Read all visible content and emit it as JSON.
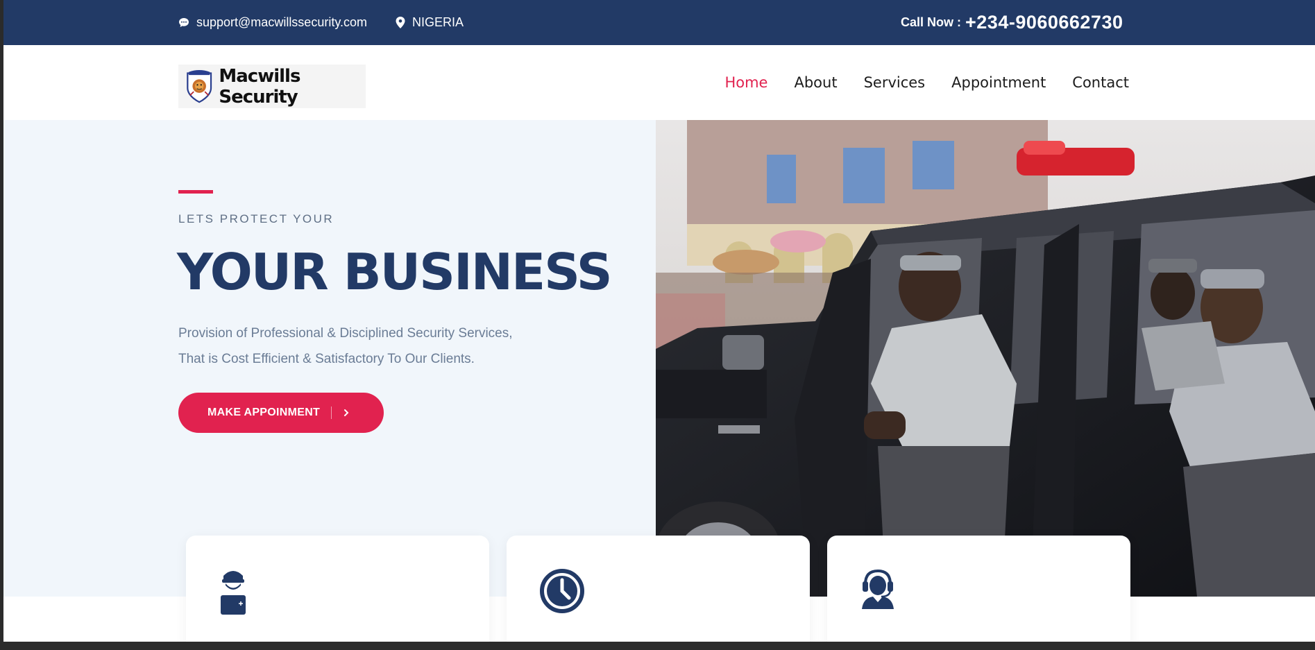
{
  "topbar": {
    "email": "support@macwillssecurity.com",
    "location": "NIGERIA",
    "call_label": "Call Now :",
    "phone": "+234-9060662730"
  },
  "header": {
    "logo_text": "Macwills Security",
    "nav": [
      {
        "label": "Home",
        "active": true
      },
      {
        "label": "About",
        "active": false
      },
      {
        "label": "Services",
        "active": false
      },
      {
        "label": "Appointment",
        "active": false
      },
      {
        "label": "Contact",
        "active": false
      }
    ]
  },
  "hero": {
    "eyebrow": "LETS PROTECT YOUR",
    "headline": "YOUR BUSINESS",
    "description_line1": "Provision of Professional & Disciplined Security Services,",
    "description_line2": "That is Cost Efficient & Satisfactory To Our Clients.",
    "cta_label": "MAKE APPOINMENT"
  },
  "cards": [
    {
      "icon": "guard-icon"
    },
    {
      "icon": "clock-icon"
    },
    {
      "icon": "support-agent-icon"
    }
  ],
  "colors": {
    "primary_navy": "#223a66",
    "accent_red": "#e1224f",
    "hero_bg": "#f1f6fb"
  }
}
